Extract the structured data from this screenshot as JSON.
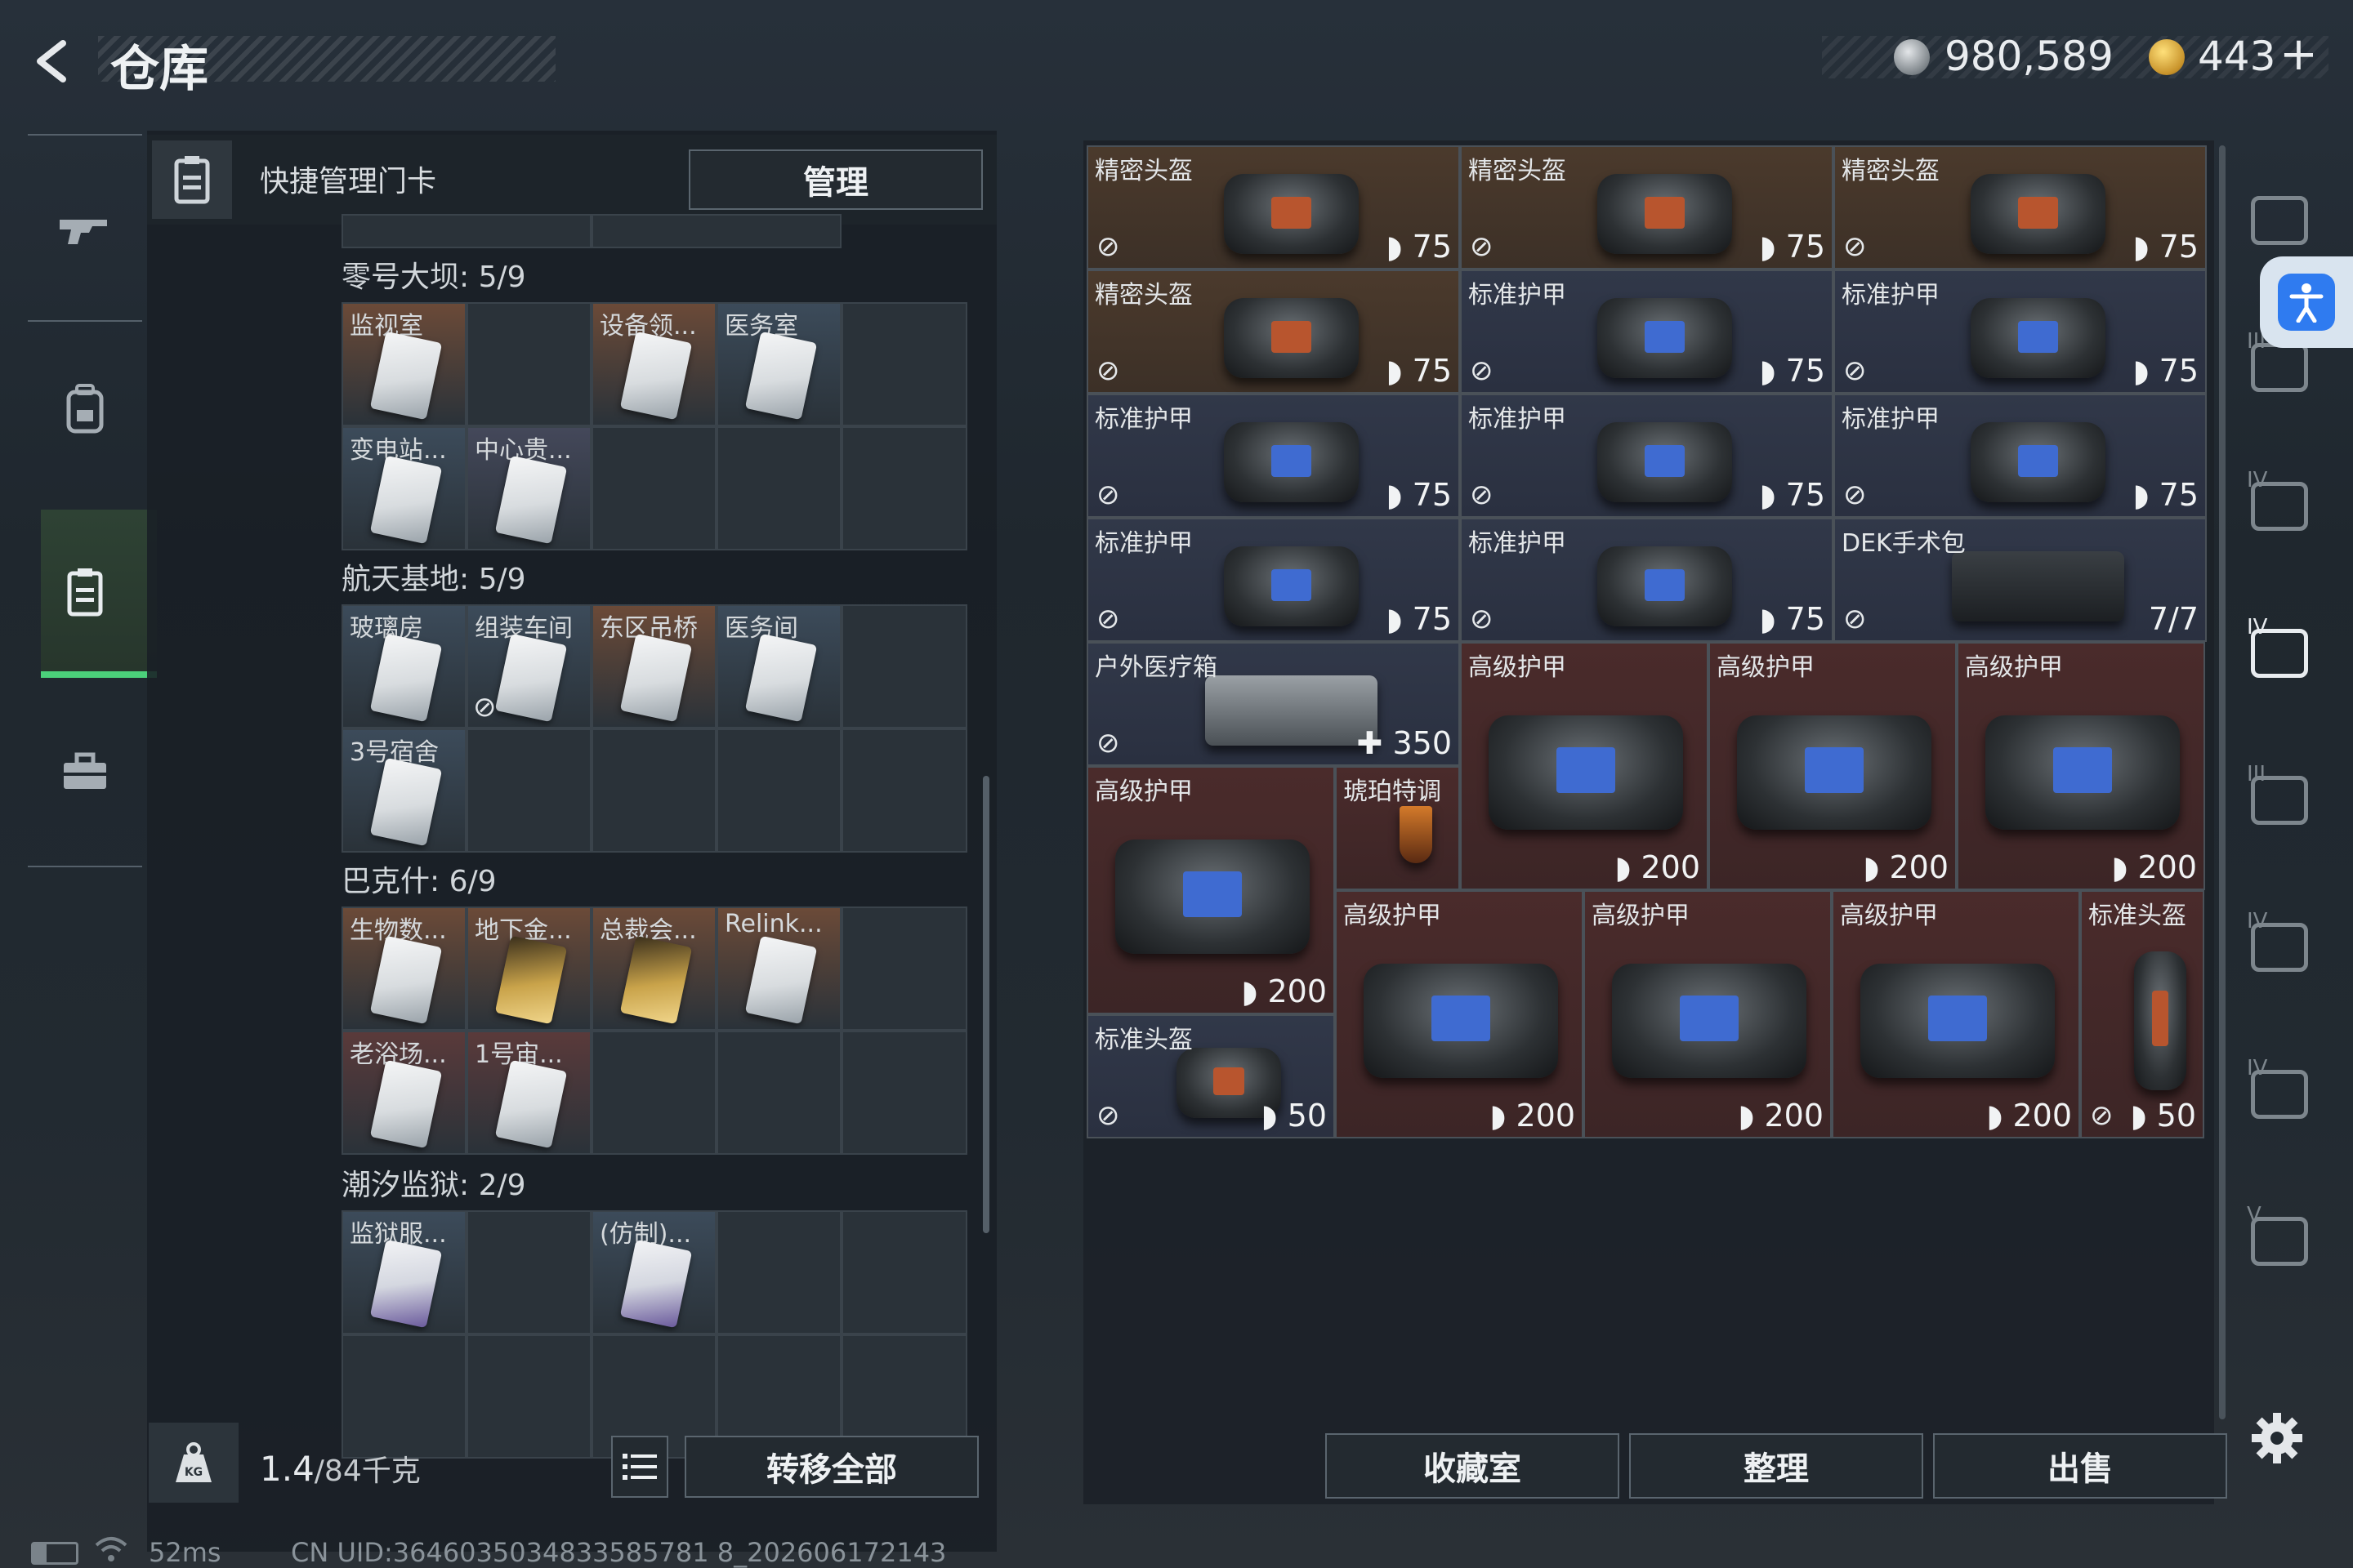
{
  "header": {
    "back_icon": "back-arrow-icon",
    "title": "仓库",
    "currency1": "980,589",
    "currency2": "443",
    "currency2_plus": "+"
  },
  "sidebar": {
    "items": [
      {
        "name": "weapon-tab",
        "icon": "gun-icon"
      },
      {
        "name": "backpack-tab",
        "icon": "backpack-icon"
      },
      {
        "name": "keycard-tab",
        "icon": "keycard-icon",
        "selected": true
      },
      {
        "name": "toolbox-tab",
        "icon": "toolbox-icon"
      }
    ]
  },
  "left_panel": {
    "title": "快捷管理门卡",
    "manage_label": "管理",
    "sections": [
      {
        "title": "零号大坝: 5/9",
        "cards": [
          {
            "label": "监视室",
            "color": "#6b4a38"
          },
          {
            "label": "",
            "color": ""
          },
          {
            "label": "设备领...",
            "color": "#6b4a38"
          },
          {
            "label": "医务室",
            "color": "#3c4b5a"
          },
          {
            "label": "",
            "color": ""
          },
          {
            "label": "变电站...",
            "color": "#3c4b5a"
          },
          {
            "label": "中心贵...",
            "color": "#44485a"
          }
        ]
      },
      {
        "title": "航天基地: 5/9",
        "cards": [
          {
            "label": "玻璃房",
            "color": "#3c4b5a"
          },
          {
            "label": "组装车间",
            "color": "#3c4b5a"
          },
          {
            "label": "东区吊桥",
            "color": "#6b4a38"
          },
          {
            "label": "医务间",
            "color": "#3c4b5a"
          },
          {
            "label": "",
            "color": ""
          },
          {
            "label": "3号宿舍",
            "color": "#3c4b5a"
          }
        ]
      },
      {
        "title": "巴克什: 6/9",
        "cards": [
          {
            "label": "生物数...",
            "color": "#6b4a38"
          },
          {
            "label": "地下金...",
            "color": "#6b4a38"
          },
          {
            "label": "总裁会...",
            "color": "#6b4a38"
          },
          {
            "label": "Relink...",
            "color": "#6b4a38"
          },
          {
            "label": "",
            "color": ""
          },
          {
            "label": "老浴场...",
            "color": "#5a3a3a"
          },
          {
            "label": "1号宙...",
            "color": "#5a3a3a"
          }
        ]
      },
      {
        "title": "潮汐监狱: 2/9",
        "cards": [
          {
            "label": "监狱服...",
            "color": "#3c4b5a"
          },
          {
            "label": "",
            "color": ""
          },
          {
            "label": "(仿制)...",
            "color": "#3c4b5a"
          }
        ]
      }
    ],
    "weight_icon": "kg-weight-icon",
    "weight_current": "1.4",
    "weight_total": "/84千克",
    "list_icon": "list-icon",
    "transfer_label": "转移全部"
  },
  "inventory": {
    "items": [
      {
        "label": "精密头盔",
        "value": "75",
        "type": "helmet",
        "bg": "brown"
      },
      {
        "label": "精密头盔",
        "value": "75",
        "type": "helmet",
        "bg": "brown"
      },
      {
        "label": "精密头盔",
        "value": "75",
        "type": "helmet",
        "bg": "brown"
      },
      {
        "label": "精密头盔",
        "value": "75",
        "type": "helmet",
        "bg": "brown"
      },
      {
        "label": "标准护甲",
        "value": "75",
        "type": "armor",
        "bg": "blue"
      },
      {
        "label": "标准护甲",
        "value": "75",
        "type": "armor",
        "bg": "blue"
      },
      {
        "label": "标准护甲",
        "value": "75",
        "type": "armor",
        "bg": "blue"
      },
      {
        "label": "标准护甲",
        "value": "75",
        "type": "armor",
        "bg": "blue"
      },
      {
        "label": "标准护甲",
        "value": "75",
        "type": "armor",
        "bg": "blue"
      },
      {
        "label": "标准护甲",
        "value": "75",
        "type": "armor",
        "bg": "blue"
      },
      {
        "label": "标准护甲",
        "value": "75",
        "type": "armor",
        "bg": "blue"
      },
      {
        "label": "DEK手术包",
        "value": "7/7",
        "type": "kit",
        "bg": "blue"
      },
      {
        "label": "户外医疗箱",
        "value": "350",
        "type": "medbox",
        "bg": "blue"
      },
      {
        "label": "高级护甲",
        "value": "200",
        "type": "bigarmor",
        "bg": "red"
      },
      {
        "label": "高级护甲",
        "value": "200",
        "type": "bigarmor",
        "bg": "red"
      },
      {
        "label": "高级护甲",
        "value": "200",
        "type": "bigarmor",
        "bg": "red"
      },
      {
        "label": "高级护甲",
        "value": "200",
        "type": "bigarmor",
        "bg": "red"
      },
      {
        "label": "琥珀特调",
        "value": "",
        "type": "drink",
        "bg": "red"
      },
      {
        "label": "高级护甲",
        "value": "200",
        "type": "bigarmor",
        "bg": "red"
      },
      {
        "label": "高级护甲",
        "value": "200",
        "type": "bigarmor",
        "bg": "red"
      },
      {
        "label": "高级护甲",
        "value": "200",
        "type": "bigarmor",
        "bg": "red"
      },
      {
        "label": "标准头盔",
        "value": "50",
        "type": "smallhelmet",
        "bg": "red"
      },
      {
        "label": "标准头盔",
        "value": "50",
        "type": "smallhelmet",
        "bg": "blue"
      }
    ],
    "collection_label": "收藏室",
    "sort_label": "整理",
    "sell_label": "出售"
  },
  "right_nav": {
    "items": [
      "helmet-slot-icon",
      "vest-iii-icon",
      "vest-iv-icon",
      "medkit-iv-icon",
      "armor-iii-icon",
      "gun-iv-icon",
      "gun-iv-2-icon",
      "gun-v-icon"
    ],
    "labels": [
      "",
      "III",
      "IV",
      "IV",
      "III",
      "IV",
      "IV",
      "V"
    ]
  },
  "status_bar": {
    "ping": "52ms",
    "uid": "CN UID:3646035034833585781 8_202606172143"
  },
  "colors": {
    "accent_green": "#4bd07a",
    "card_brown": "#4b3a2c",
    "card_blue": "#313849",
    "card_red": "#4a2b2b"
  }
}
